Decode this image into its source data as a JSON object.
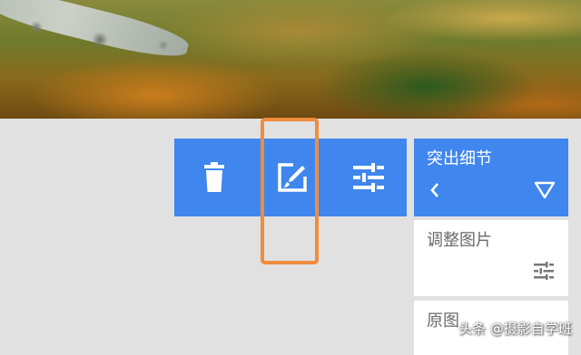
{
  "toolbar": {
    "background_color": "#3f86ee",
    "items": [
      {
        "icon": "trash-icon"
      },
      {
        "icon": "edit-image-icon"
      },
      {
        "icon": "sliders-icon"
      }
    ]
  },
  "highlight_color": "#ef8c3e",
  "panel": {
    "title": "突出细节",
    "back_icon": "chevron-left-icon",
    "toggle_icon": "triangle-down-icon",
    "items": [
      {
        "label": "调整图片",
        "icon": "sliders-icon"
      },
      {
        "label": "原图"
      }
    ]
  },
  "watermark": "头条 @摄影自学班"
}
